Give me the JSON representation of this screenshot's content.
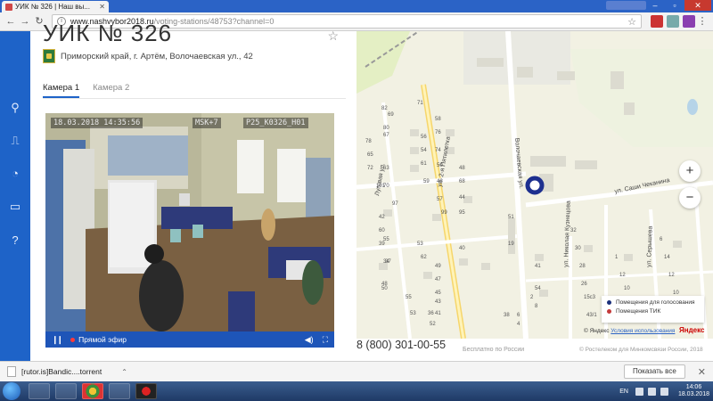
{
  "browser": {
    "tab_title": "УИК № 326 | Наш вы...",
    "url_domain": "www.nashvybor2018.ru",
    "url_path": "/voting-stations/48753?channel=0"
  },
  "station": {
    "title": "УИК № 326",
    "region": "Приморский край, г. Артём, Волочаевская ул., 42"
  },
  "camera_tabs": [
    {
      "label": "Камера 1",
      "active": true
    },
    {
      "label": "Камера 2",
      "active": false
    }
  ],
  "video": {
    "osd_datetime": "18.03.2018 14:35:56",
    "osd_timezone": "MSK+7",
    "osd_id": "P25_K0326_H01",
    "live_label": "Прямой эфир"
  },
  "footer": {
    "phone": "8 (800) 301-00-55",
    "phone_note": "Бесплатно по России",
    "copyright": "© Ростелеком для Минкомсвязи России, 2018"
  },
  "map": {
    "streets": [
      "ул. Саши Чеканина",
      "Волочаевская ул.",
      "ул. 2-я Пятилетка",
      "Луговая ул.",
      "ул. Николая Кузнецова",
      "ул. Серышева"
    ],
    "house_numbers": [
      "71",
      "69",
      "82",
      "80",
      "58",
      "78",
      "67",
      "56",
      "76",
      "65",
      "54",
      "74",
      "72",
      "63",
      "61",
      "50",
      "48",
      "70",
      "59",
      "46",
      "68",
      "57",
      "44",
      "101",
      "97",
      "42",
      "99",
      "95",
      "60",
      "55",
      "53",
      "51",
      "19",
      "40",
      "34",
      "62",
      "49",
      "47",
      "45",
      "43",
      "41",
      "39",
      "37",
      "55",
      "53",
      "52",
      "50",
      "48",
      "41",
      "54",
      "8",
      "6",
      "4",
      "2",
      "38",
      "36",
      "32",
      "30",
      "28",
      "26",
      "15с3",
      "43/1",
      "1",
      "12",
      "10",
      "8",
      "6",
      "14",
      "12",
      "10",
      "8",
      "6",
      "4"
    ],
    "legend": [
      {
        "label": "Помещения для голосования",
        "color": "#1a2f7a"
      },
      {
        "label": "Помещения ТИК",
        "color": "#c43a3a"
      }
    ],
    "attribution_prefix": "© Яндекс",
    "attribution_link": "Условия использования",
    "yandex": "Яндекс",
    "zoom_in": "+",
    "zoom_out": "−",
    "marker_color": "#1d2f8f"
  },
  "download": {
    "filename": "[rutor.is]Bandic....torrent",
    "show_all": "Показать все"
  },
  "taskbar": {
    "lang": "EN",
    "time": "14:06",
    "date": "18.03.2018"
  }
}
